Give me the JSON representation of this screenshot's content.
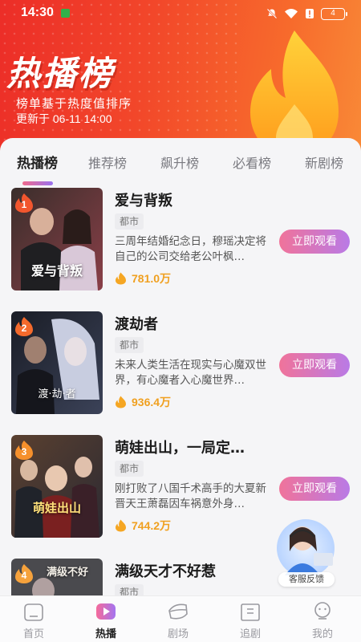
{
  "status_bar": {
    "time": "14:30",
    "battery": "4"
  },
  "hero": {
    "title": "热播榜",
    "subtitle": "榜单基于热度值排序",
    "updated": "更新于 06-11 14:00"
  },
  "tabs": [
    {
      "label": "热播榜",
      "active": true
    },
    {
      "label": "推荐榜",
      "active": false
    },
    {
      "label": "飙升榜",
      "active": false
    },
    {
      "label": "必看榜",
      "active": false
    },
    {
      "label": "新剧榜",
      "active": false
    }
  ],
  "items": [
    {
      "rank": "1",
      "title": "爱与背叛",
      "tag": "都市",
      "desc": "三周年结婚纪念日，穆瑶决定将自己的公司交给老公叶枫…",
      "heat": "781.0万",
      "button": "立即观看",
      "cover_text": "爱与背叛"
    },
    {
      "rank": "2",
      "title": "渡劫者",
      "tag": "都市",
      "desc": "未来人类生活在现实与心魔双世界，有心魔者入心魔世界…",
      "heat": "936.4万",
      "button": "立即观看",
      "cover_text": "渡·劫·者"
    },
    {
      "rank": "3",
      "title": "萌娃出山，一局定…",
      "tag": "都市",
      "desc": "刚打败了八国千术高手的大夏新晋天王萧磊因车祸意外身…",
      "heat": "744.2万",
      "button": "立即观看",
      "cover_text": "萌娃出山"
    },
    {
      "rank": "4",
      "title": "满级天才不好惹",
      "tag": "都市",
      "desc": "",
      "heat": "",
      "button": "",
      "cover_text": "满级不好"
    }
  ],
  "service": {
    "label": "客服反馈"
  },
  "nav": [
    {
      "label": "首页",
      "icon": "home-icon",
      "active": false
    },
    {
      "label": "热播",
      "icon": "play-icon",
      "active": true
    },
    {
      "label": "剧场",
      "icon": "theater-icon",
      "active": false
    },
    {
      "label": "追剧",
      "icon": "follow-icon",
      "active": false
    },
    {
      "label": "我的",
      "icon": "profile-icon",
      "active": false
    }
  ],
  "colors": {
    "accent": "#ec2d28",
    "heat": "#f0a020",
    "button_start": "#f0739a",
    "button_end": "#b97ae6"
  }
}
